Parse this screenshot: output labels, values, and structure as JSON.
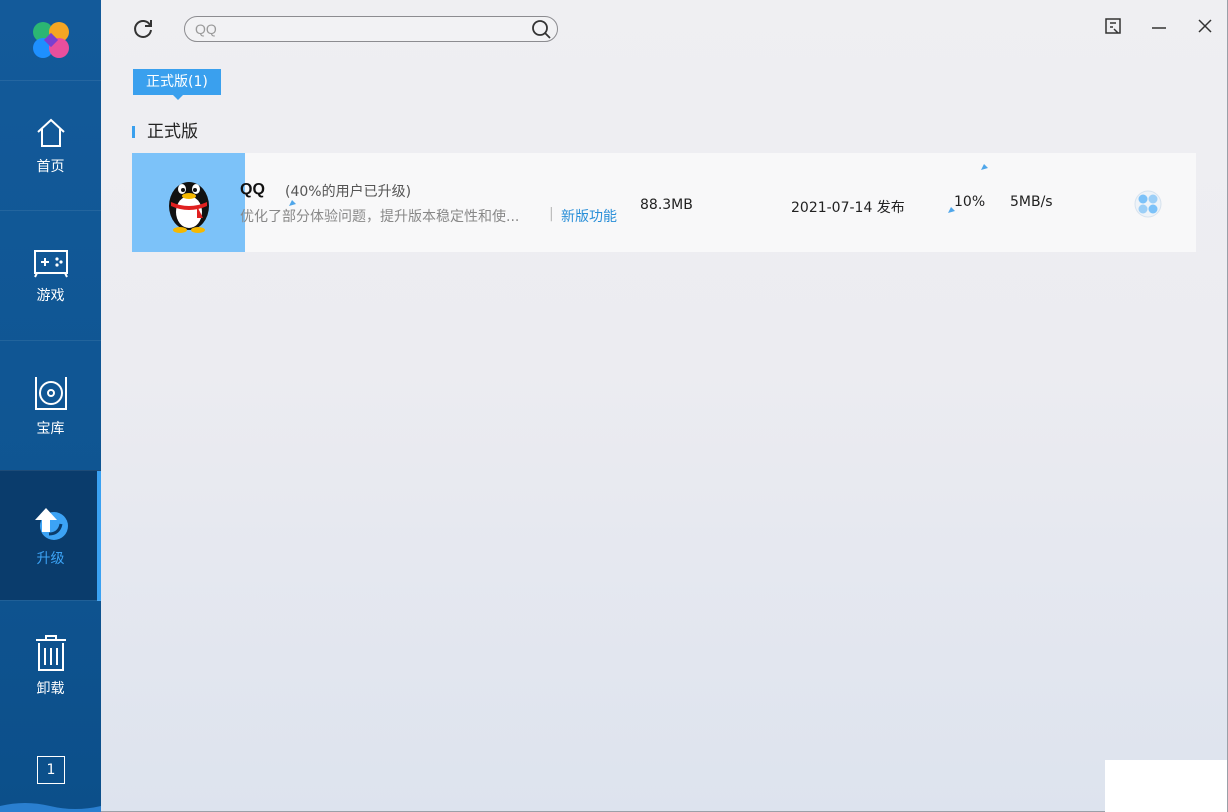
{
  "sidebar": {
    "items": [
      {
        "label": "首页",
        "icon": "home-icon"
      },
      {
        "label": "游戏",
        "icon": "gamepad-icon"
      },
      {
        "label": "宝库",
        "icon": "vault-icon"
      },
      {
        "label": "升级",
        "icon": "upgrade-icon",
        "active": true
      },
      {
        "label": "卸载",
        "icon": "trash-icon"
      }
    ],
    "page_number": "1"
  },
  "search": {
    "placeholder": "QQ"
  },
  "tabs": [
    {
      "label": "正式版(1)",
      "active": true
    }
  ],
  "section": {
    "title": "正式版"
  },
  "apps": [
    {
      "name": "QQ",
      "upgrade_ratio": "(40%的用户已升级)",
      "description": "优化了部分体验问题，提升版本稳定性和使...",
      "separator": "|",
      "link": "新版功能",
      "size": "88.3MB",
      "date": "2021-07-14 发布",
      "progress": "10%",
      "speed": "5MB/s"
    }
  ],
  "colors": {
    "sidebar": "#135a9a",
    "accent": "#3aa0ee",
    "icon_bg": "#7cc2f9",
    "link": "#2a8fd8"
  }
}
